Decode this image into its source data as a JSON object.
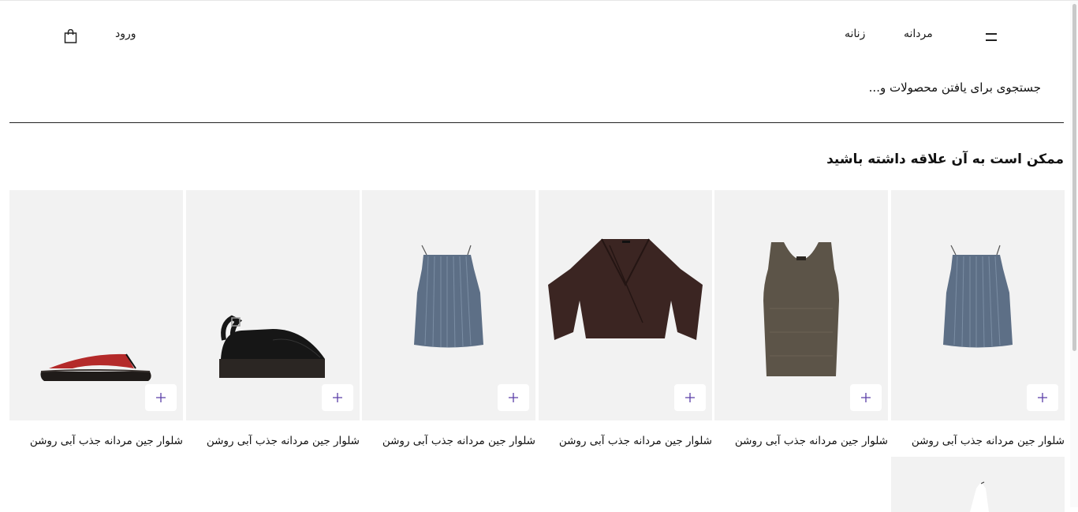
{
  "header": {
    "nav_men": "مردانه",
    "nav_women": "زنانه",
    "login": "ورود",
    "menu_icon": "hamburger-icon",
    "bag_icon": "shopping-bag-icon"
  },
  "search": {
    "placeholder": "جستجوی برای یافتن محصولات و..."
  },
  "recommendations": {
    "title": "ممکن است به آن علاقه داشته باشید",
    "products": [
      {
        "title": "شلوار جین مردانه جذب آبی روشن",
        "image": "blue-camisole"
      },
      {
        "title": "شلوار جین مردانه جذب آبی روشن",
        "image": "brown-knit-tank-top"
      },
      {
        "title": "شلوار جین مردانه جذب آبی روشن",
        "image": "brown-wrap-crop-jacket"
      },
      {
        "title": "شلوار جین مردانه جذب آبی روشن",
        "image": "blue-camisole"
      },
      {
        "title": "شلوار جین مردانه جذب آبی روشن",
        "image": "black-platform-slingback-sandal"
      },
      {
        "title": "شلوار جین مردانه جذب آبی روشن",
        "image": "red-black-flip-flop"
      }
    ],
    "add_icon": "plus-icon"
  },
  "colors": {
    "accent": "#1a1a1a",
    "card_bg": "#f2f2f2",
    "plus_color": "#5b3fa8"
  }
}
